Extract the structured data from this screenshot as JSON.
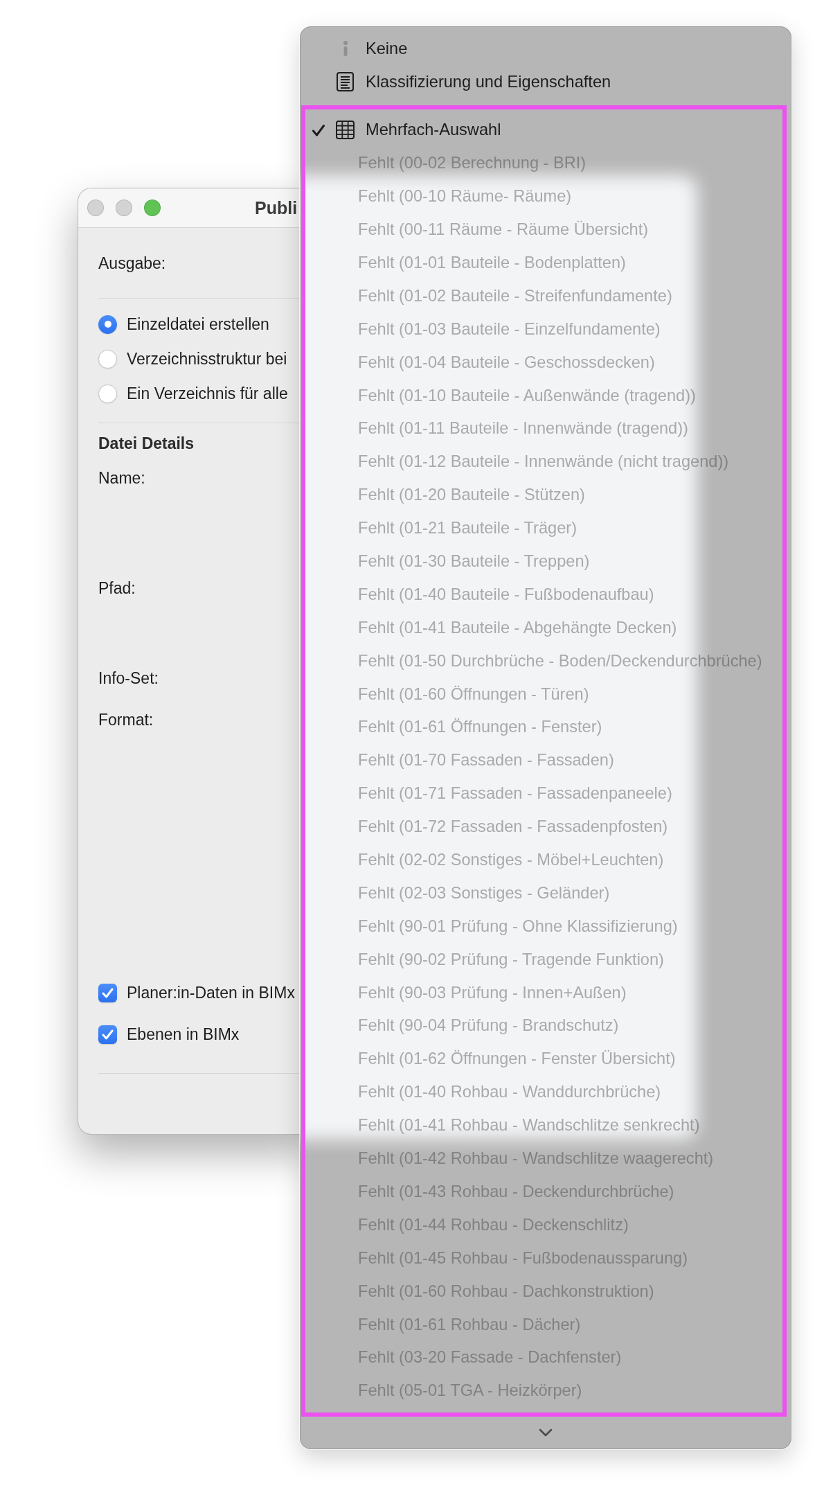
{
  "window": {
    "title": "Publi",
    "controls": [
      {
        "kind": "close",
        "disabled": true
      },
      {
        "kind": "minimize",
        "disabled": true
      },
      {
        "kind": "zoom",
        "disabled": false
      }
    ]
  },
  "output": {
    "label": "Ausgabe:",
    "options": [
      {
        "label": "Einzeldatei erstellen",
        "selected": true
      },
      {
        "label": "Verzeichnisstruktur bei",
        "selected": false
      },
      {
        "label": "Ein Verzeichnis für alle",
        "selected": false
      }
    ]
  },
  "file_details": {
    "heading": "Datei Details",
    "labels": [
      "Name:",
      "Pfad:",
      "Info-Set:",
      "Format:"
    ]
  },
  "checkboxes": [
    {
      "label": "Planer:in-Daten in BIMx",
      "checked": true
    },
    {
      "label": "Ebenen in BIMx",
      "checked": true
    }
  ],
  "menu": {
    "more_below": true,
    "sections": [
      {
        "highlighted": false,
        "items": [
          {
            "label": "Keine",
            "kind": "info",
            "checked": false,
            "disabled": false
          },
          {
            "label": "Klassifizierung und Eigenschaften",
            "kind": "sheet",
            "checked": false,
            "disabled": false
          }
        ]
      },
      {
        "highlighted": true,
        "items": [
          {
            "label": "Mehrfach-Auswahl",
            "kind": "grid",
            "checked": true,
            "disabled": false
          },
          {
            "label": "Fehlt (00-02 Berechnung - BRI)",
            "kind": "plain",
            "checked": false,
            "disabled": true
          },
          {
            "label": "Fehlt (00-10 Räume- Räume)",
            "kind": "plain",
            "checked": false,
            "disabled": true
          },
          {
            "label": "Fehlt (00-11 Räume - Räume Übersicht)",
            "kind": "plain",
            "checked": false,
            "disabled": true
          },
          {
            "label": "Fehlt (01-01 Bauteile - Bodenplatten)",
            "kind": "plain",
            "checked": false,
            "disabled": true
          },
          {
            "label": "Fehlt (01-02 Bauteile - Streifenfundamente)",
            "kind": "plain",
            "checked": false,
            "disabled": true
          },
          {
            "label": "Fehlt (01-03 Bauteile - Einzelfundamente)",
            "kind": "plain",
            "checked": false,
            "disabled": true
          },
          {
            "label": "Fehlt (01-04 Bauteile - Geschossdecken)",
            "kind": "plain",
            "checked": false,
            "disabled": true
          },
          {
            "label": "Fehlt (01-10 Bauteile - Außenwände (tragend))",
            "kind": "plain",
            "checked": false,
            "disabled": true
          },
          {
            "label": "Fehlt (01-11 Bauteile - Innenwände (tragend))",
            "kind": "plain",
            "checked": false,
            "disabled": true
          },
          {
            "label": "Fehlt (01-12 Bauteile - Innenwände (nicht tragend))",
            "kind": "plain",
            "checked": false,
            "disabled": true
          },
          {
            "label": "Fehlt (01-20 Bauteile - Stützen)",
            "kind": "plain",
            "checked": false,
            "disabled": true
          },
          {
            "label": "Fehlt (01-21 Bauteile - Träger)",
            "kind": "plain",
            "checked": false,
            "disabled": true
          },
          {
            "label": "Fehlt (01-30 Bauteile - Treppen)",
            "kind": "plain",
            "checked": false,
            "disabled": true
          },
          {
            "label": "Fehlt (01-40 Bauteile - Fußbodenaufbau)",
            "kind": "plain",
            "checked": false,
            "disabled": true
          },
          {
            "label": "Fehlt (01-41 Bauteile - Abgehängte Decken)",
            "kind": "plain",
            "checked": false,
            "disabled": true
          },
          {
            "label": "Fehlt (01-50 Durchbrüche - Boden/Deckendurchbrüche)",
            "kind": "plain",
            "checked": false,
            "disabled": true
          },
          {
            "label": "Fehlt (01-60 Öffnungen - Türen)",
            "kind": "plain",
            "checked": false,
            "disabled": true
          },
          {
            "label": "Fehlt (01-61 Öffnungen - Fenster)",
            "kind": "plain",
            "checked": false,
            "disabled": true
          },
          {
            "label": "Fehlt (01-70 Fassaden - Fassaden)",
            "kind": "plain",
            "checked": false,
            "disabled": true
          },
          {
            "label": "Fehlt (01-71 Fassaden  - Fassadenpaneele)",
            "kind": "plain",
            "checked": false,
            "disabled": true
          },
          {
            "label": "Fehlt (01-72 Fassaden - Fassadenpfosten)",
            "kind": "plain",
            "checked": false,
            "disabled": true
          },
          {
            "label": "Fehlt (02-02 Sonstiges - Möbel+Leuchten)",
            "kind": "plain",
            "checked": false,
            "disabled": true
          },
          {
            "label": "Fehlt (02-03 Sonstiges - Geländer)",
            "kind": "plain",
            "checked": false,
            "disabled": true
          },
          {
            "label": "Fehlt (90-01 Prüfung - Ohne Klassifizierung)",
            "kind": "plain",
            "checked": false,
            "disabled": true
          },
          {
            "label": "Fehlt (90-02 Prüfung - Tragende Funktion)",
            "kind": "plain",
            "checked": false,
            "disabled": true
          },
          {
            "label": "Fehlt (90-03 Prüfung - Innen+Außen)",
            "kind": "plain",
            "checked": false,
            "disabled": true
          },
          {
            "label": "Fehlt (90-04 Prüfung - Brandschutz)",
            "kind": "plain",
            "checked": false,
            "disabled": true
          },
          {
            "label": "Fehlt (01-62 Öffnungen - Fenster Übersicht)",
            "kind": "plain",
            "checked": false,
            "disabled": true
          },
          {
            "label": "Fehlt (01-40 Rohbau - Wanddurchbrüche)",
            "kind": "plain",
            "checked": false,
            "disabled": true
          },
          {
            "label": "Fehlt (01-41 Rohbau - Wandschlitze senkrecht)",
            "kind": "plain",
            "checked": false,
            "disabled": true
          },
          {
            "label": "Fehlt (01-42 Rohbau - Wandschlitze waagerecht)",
            "kind": "plain",
            "checked": false,
            "disabled": true
          },
          {
            "label": "Fehlt (01-43 Rohbau - Deckendurchbrüche)",
            "kind": "plain",
            "checked": false,
            "disabled": true
          },
          {
            "label": "Fehlt (01-44 Rohbau - Deckenschlitz)",
            "kind": "plain",
            "checked": false,
            "disabled": true
          },
          {
            "label": "Fehlt (01-45 Rohbau - Fußbodenaussparung)",
            "kind": "plain",
            "checked": false,
            "disabled": true
          },
          {
            "label": "Fehlt (01-60 Rohbau - Dachkonstruktion)",
            "kind": "plain",
            "checked": false,
            "disabled": true
          },
          {
            "label": "Fehlt (01-61 Rohbau - Dächer)",
            "kind": "plain",
            "checked": false,
            "disabled": true
          },
          {
            "label": "Fehlt (03-20 Fassade - Dachfenster)",
            "kind": "plain",
            "checked": false,
            "disabled": true
          },
          {
            "label": "Fehlt (05-01 TGA - Heizkörper)",
            "kind": "plain",
            "checked": false,
            "disabled": true
          }
        ]
      }
    ]
  }
}
